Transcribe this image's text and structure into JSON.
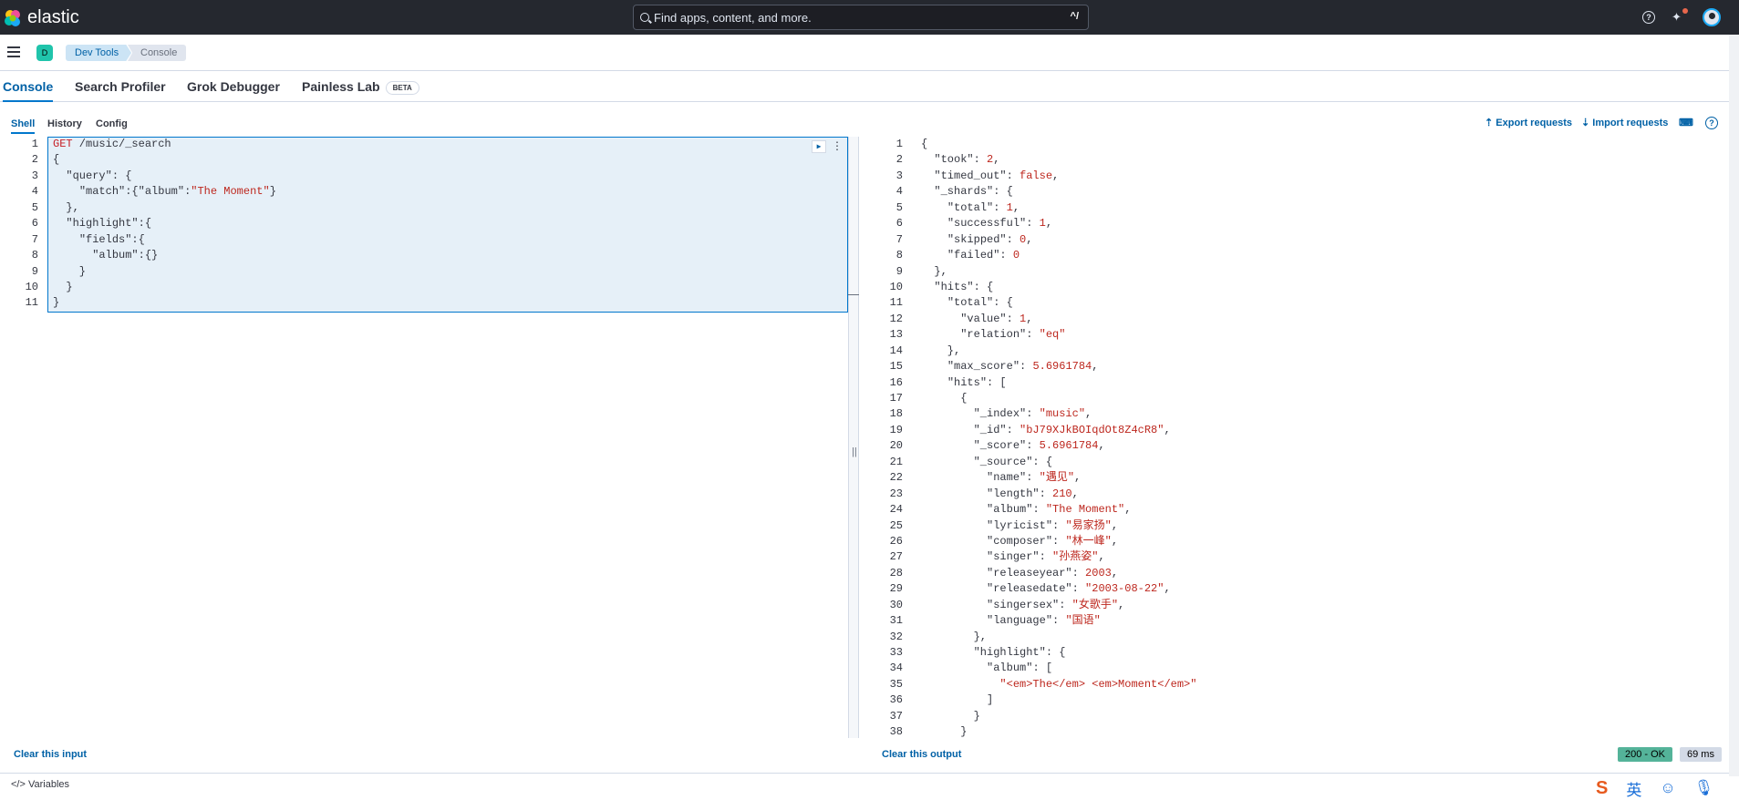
{
  "header": {
    "brand": "elastic",
    "search_placeholder": "Find apps, content, and more.",
    "search_shortcut": "^/",
    "space_initial": "D",
    "breadcrumbs": [
      "Dev Tools",
      "Console"
    ]
  },
  "tabs": [
    {
      "label": "Console",
      "active": true
    },
    {
      "label": "Search Profiler",
      "active": false
    },
    {
      "label": "Grok Debugger",
      "active": false
    },
    {
      "label": "Painless Lab",
      "badge": "BETA",
      "active": false
    }
  ],
  "subtabs": [
    {
      "label": "Shell",
      "active": true
    },
    {
      "label": "History",
      "active": false
    },
    {
      "label": "Config",
      "active": false
    }
  ],
  "actions": {
    "export": "Export requests",
    "import": "Import requests"
  },
  "editor": {
    "lines": [
      "GET /music/_search",
      "{",
      "  \"query\": {",
      "    \"match\":{\"album\":\"The Moment\"}",
      "  },",
      "  \"highlight\":{",
      "    \"fields\":{",
      "      \"album\":{}",
      "    }",
      "  }",
      "}"
    ]
  },
  "output": {
    "lines": [
      "{",
      "  \"took\": 2,",
      "  \"timed_out\": false,",
      "  \"_shards\": {",
      "    \"total\": 1,",
      "    \"successful\": 1,",
      "    \"skipped\": 0,",
      "    \"failed\": 0",
      "  },",
      "  \"hits\": {",
      "    \"total\": {",
      "      \"value\": 1,",
      "      \"relation\": \"eq\"",
      "    },",
      "    \"max_score\": 5.6961784,",
      "    \"hits\": [",
      "      {",
      "        \"_index\": \"music\",",
      "        \"_id\": \"bJ79XJkBOIqdOt8Z4cR8\",",
      "        \"_score\": 5.6961784,",
      "        \"_source\": {",
      "          \"name\": \"遇见\",",
      "          \"length\": 210,",
      "          \"album\": \"The Moment\",",
      "          \"lyricist\": \"易家扬\",",
      "          \"composer\": \"林一峰\",",
      "          \"singer\": \"孙燕姿\",",
      "          \"releaseyear\": 2003,",
      "          \"releasedate\": \"2003-08-22\",",
      "          \"singersex\": \"女歌手\",",
      "          \"language\": \"国语\"",
      "        },",
      "        \"highlight\": {",
      "          \"album\": [",
      "            \"<em>The</em> <em>Moment</em>\"",
      "          ]",
      "        }",
      "      }"
    ]
  },
  "footer": {
    "clear_input": "Clear this input",
    "clear_output": "Clear this output",
    "status": "200 - OK",
    "time": "69 ms",
    "variables": "Variables"
  },
  "ime": [
    "英"
  ]
}
